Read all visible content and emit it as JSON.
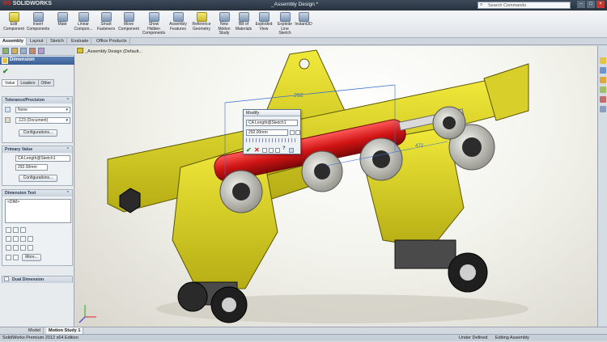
{
  "app": {
    "logo_brand": "DS",
    "logo_text": "SOLIDWORKS",
    "title": "_Assembly Design *",
    "search_placeholder": "Search Commands"
  },
  "commands": [
    {
      "label": "Edit\nComponent",
      "icon": "edit-component-icon"
    },
    {
      "label": "Insert\nComponents",
      "icon": "insert-components-icon"
    },
    {
      "label": "Mate",
      "icon": "mate-icon"
    },
    {
      "label": "Linear\nCompon...",
      "icon": "linear-pattern-icon"
    },
    {
      "label": "Smart\nFasteners",
      "icon": "smart-fasteners-icon"
    },
    {
      "label": "Move\nComponent",
      "icon": "move-component-icon"
    },
    {
      "label": "Show\nHidden\nComponents",
      "icon": "show-hidden-icon"
    },
    {
      "label": "Assembly\nFeatures",
      "icon": "assembly-features-icon"
    },
    {
      "label": "Reference\nGeometry",
      "icon": "reference-geometry-icon"
    },
    {
      "label": "New\nMotion\nStudy",
      "icon": "motion-study-icon"
    },
    {
      "label": "Bill of\nMaterials",
      "icon": "bom-icon"
    },
    {
      "label": "Exploded\nView",
      "icon": "exploded-view-icon"
    },
    {
      "label": "Explode\nLine\nSketch",
      "icon": "explode-line-icon"
    },
    {
      "label": "Instant3D",
      "icon": "instant3d-icon"
    }
  ],
  "tabs": [
    "Assembly",
    "Layout",
    "Sketch",
    "Evaluate",
    "Office Products"
  ],
  "property_manager": {
    "title": "Dimension",
    "subtabs": [
      "Value",
      "Leaders",
      "Other"
    ],
    "tolerance": {
      "title": "Tolerance/Precision",
      "tolerance_type": "None",
      "precision": ".123 (Document)",
      "config_button": "Configurations..."
    },
    "primary": {
      "title": "Primary Value",
      "name": "CA Length@Sketch1",
      "value": "292.00mm",
      "config_button": "Configurations..."
    },
    "dim_text": {
      "title": "Dimension Text",
      "text": "<DIM>",
      "more_button": "More..."
    },
    "dual": {
      "title": "Dual Dimension"
    }
  },
  "viewport": {
    "tree_label": "_Assembly Design (Default...",
    "dim_left": "292",
    "dim_right": "472"
  },
  "modify": {
    "title": "Modify",
    "name": "CA Length@Sketch1",
    "value": "292.00mm"
  },
  "bottom_tabs": [
    "Model",
    "Motion Study 1"
  ],
  "status": {
    "edition": "SolidWorks Premium 2012 x64 Edition",
    "state": "Under Defined",
    "mode": "Editing Assembly"
  }
}
